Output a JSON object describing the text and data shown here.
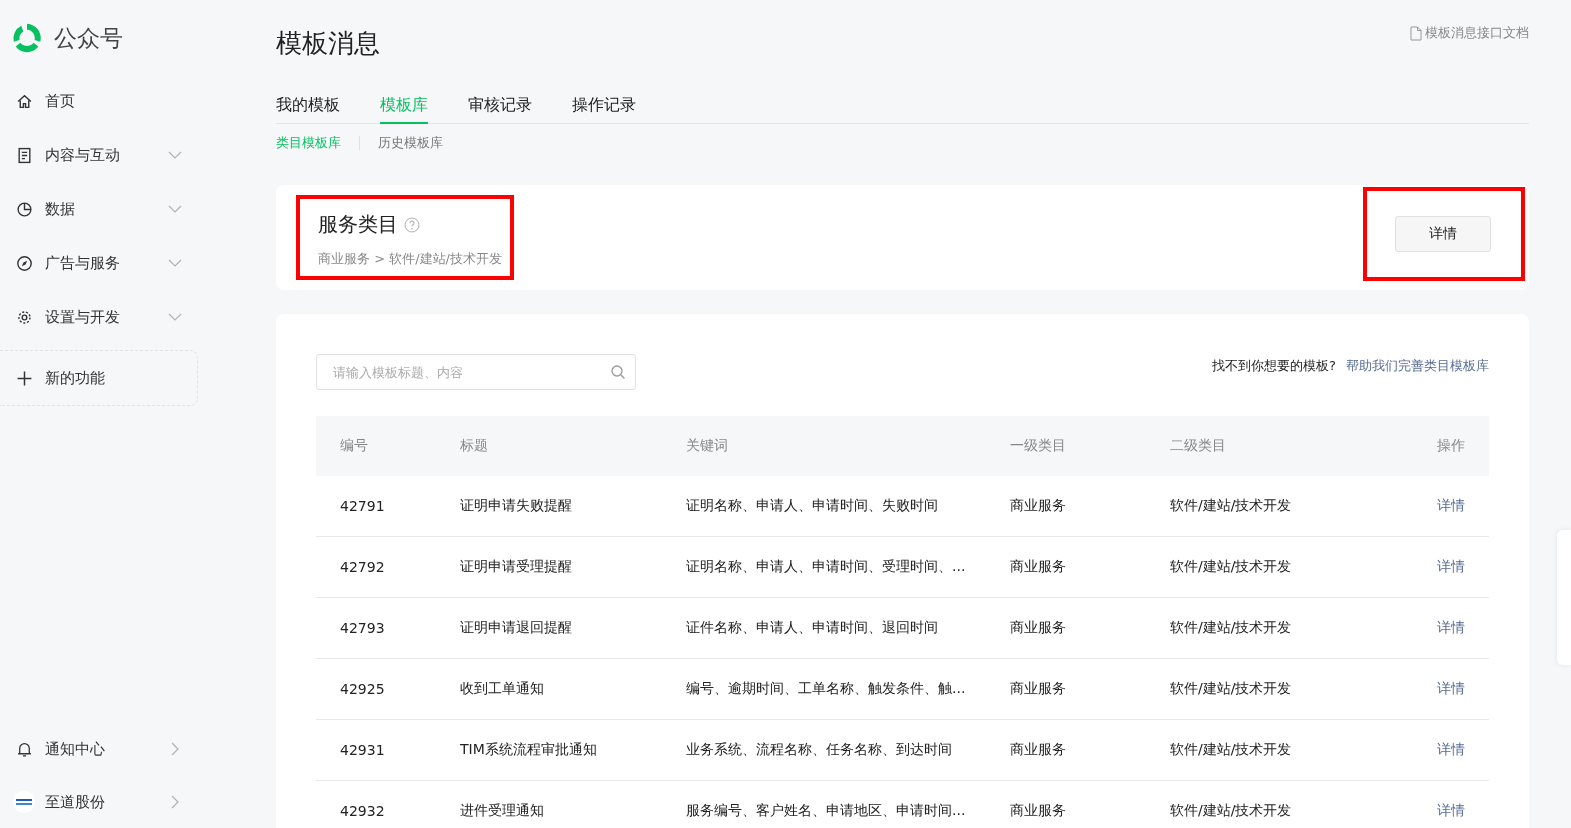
{
  "sidebar": {
    "brand": "公众号",
    "nav": [
      {
        "label": "首页",
        "kind": "link"
      },
      {
        "label": "内容与互动",
        "kind": "group",
        "expanded": false
      },
      {
        "label": "数据",
        "kind": "group",
        "expanded": false
      },
      {
        "label": "广告与服务",
        "kind": "group",
        "expanded": false
      },
      {
        "label": "设置与开发",
        "kind": "group",
        "expanded": false
      }
    ],
    "new_feature": "新的功能",
    "bottom": [
      {
        "label": "通知中心",
        "kind": "bell"
      },
      {
        "label": "至道股份",
        "kind": "avatar"
      }
    ]
  },
  "page": {
    "title": "模板消息",
    "doc_link": "模板消息接口文档"
  },
  "tabs": [
    {
      "label": "我的模板",
      "selected": false
    },
    {
      "label": "模板库",
      "selected": true
    },
    {
      "label": "审核记录",
      "selected": false
    },
    {
      "label": "操作记录",
      "selected": false
    }
  ],
  "subtabs": [
    {
      "label": "类目模板库",
      "selected": true
    },
    {
      "label": "历史模板库",
      "selected": false
    }
  ],
  "category": {
    "title": "服务类目",
    "path": "商业服务 > 软件/建站/技术开发",
    "highlighted": true
  },
  "details_button": {
    "label": "详情",
    "highlighted": true
  },
  "search": {
    "placeholder": "请输入模板标题、内容"
  },
  "help": {
    "text": "找不到你想要的模板?",
    "link": "帮助我们完善类目模板库"
  },
  "table": {
    "columns": [
      "编号",
      "标题",
      "关键词",
      "一级类目",
      "二级类目",
      "操作"
    ],
    "rows": [
      {
        "id": "42791",
        "title": "证明申请失败提醒",
        "keywords": "证明名称、申请人、申请时间、失败时间",
        "level1": "商业服务",
        "level2": "软件/建站/技术开发",
        "action": "详情"
      },
      {
        "id": "42792",
        "title": "证明申请受理提醒",
        "keywords": "证明名称、申请人、申请时间、受理时间、...",
        "level1": "商业服务",
        "level2": "软件/建站/技术开发",
        "action": "详情"
      },
      {
        "id": "42793",
        "title": "证明申请退回提醒",
        "keywords": "证件名称、申请人、申请时间、退回时间",
        "level1": "商业服务",
        "level2": "软件/建站/技术开发",
        "action": "详情"
      },
      {
        "id": "42925",
        "title": "收到工单通知",
        "keywords": "编号、逾期时间、工单名称、触发条件、触...",
        "level1": "商业服务",
        "level2": "软件/建站/技术开发",
        "action": "详情"
      },
      {
        "id": "42931",
        "title": "TIM系统流程审批通知",
        "keywords": "业务系统、流程名称、任务名称、到达时间",
        "level1": "商业服务",
        "level2": "软件/建站/技术开发",
        "action": "详情"
      },
      {
        "id": "42932",
        "title": "进件受理通知",
        "keywords": "服务编号、客户姓名、申请地区、申请时间...",
        "level1": "商业服务",
        "level2": "软件/建站/技术开发",
        "action": "详情"
      }
    ]
  }
}
